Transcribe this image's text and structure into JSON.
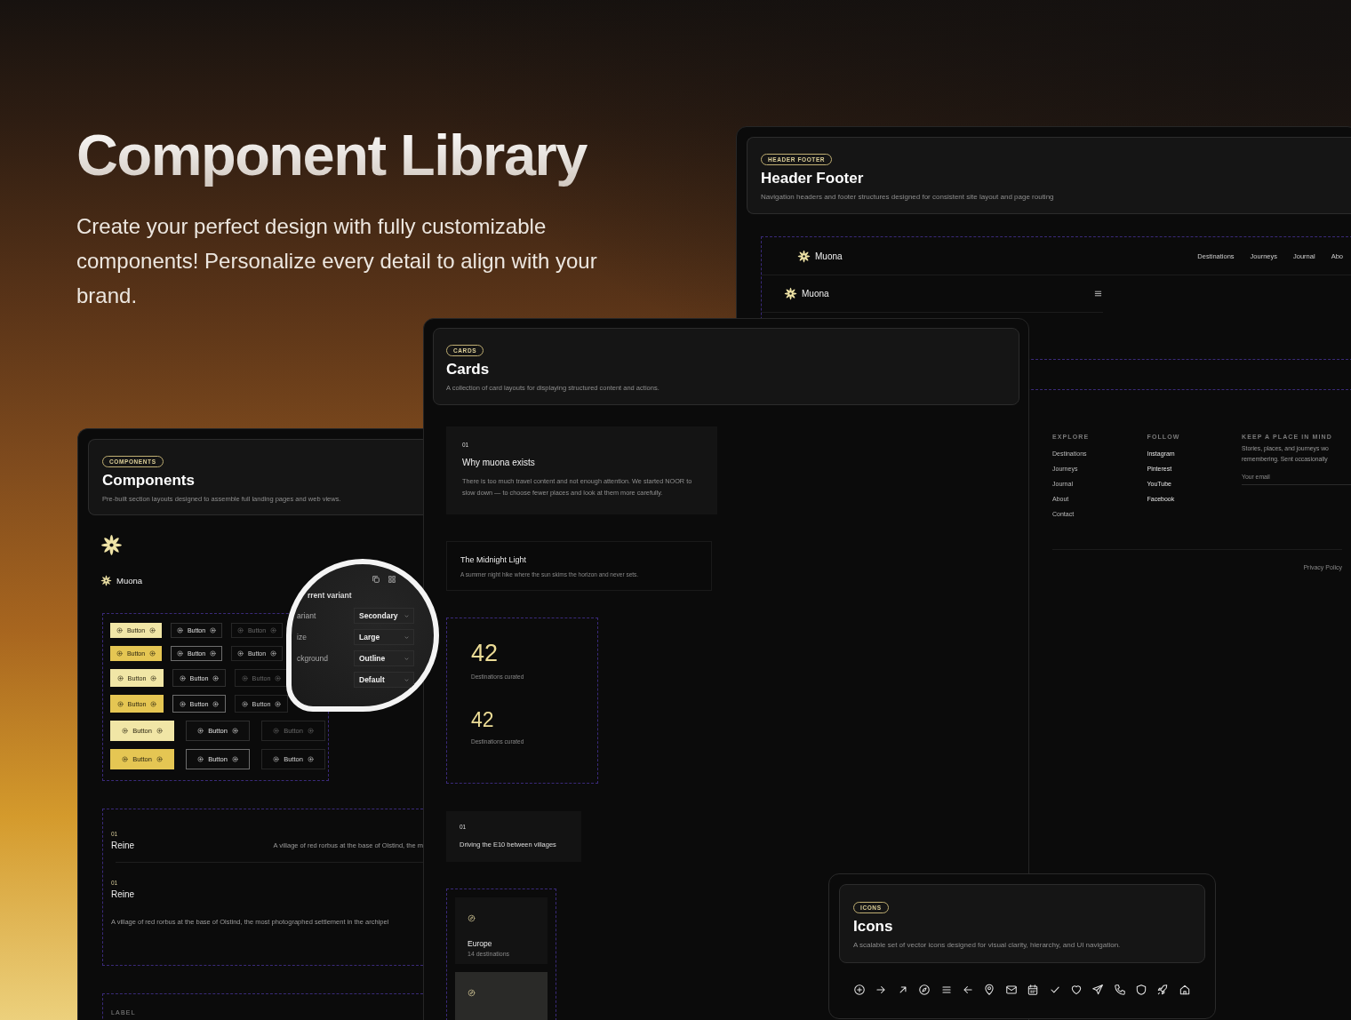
{
  "hero": {
    "title": "Component Library",
    "subtitle": "Create your perfect design with fully customizable components! Personalize every detail to align with your brand."
  },
  "header_footer": {
    "badge": "HEADER FOOTER",
    "title": "Header Footer",
    "description": "Navigation headers and footer structures designed for consistent site layout and page routing",
    "desktop_nav": {
      "brand": "Muona",
      "links": [
        "Destinations",
        "Journeys",
        "Journal",
        "Abo"
      ]
    },
    "mobile_nav": {
      "brand": "Muona"
    },
    "footer": {
      "columns": [
        {
          "heading": "EXPLORE",
          "links": [
            "Destinations",
            "Journeys",
            "Journal",
            "About",
            "Contact"
          ]
        },
        {
          "heading": "FOLLOW",
          "links": [
            "Instagram",
            "Pinterest",
            "YouTube",
            "Facebook"
          ]
        }
      ],
      "newsletter": {
        "heading": "KEEP A PLACE IN MIND",
        "lines": [
          "Stories, places, and journeys wo",
          "remembering. Sent occasionally"
        ],
        "email_placeholder": "Your email"
      },
      "legal_link": "Privacy Policy"
    }
  },
  "components": {
    "badge": "COMPONENTS",
    "title": "Components",
    "description": "Pre-built section layouts designed to assemble full landing pages and web views.",
    "brand": "Muona",
    "button_rows": [
      {
        "kind": "small",
        "buttons": [
          {
            "label": "Button",
            "kind": "primary",
            "hover": false
          },
          {
            "label": "Button",
            "kind": "outline",
            "hover": false
          },
          {
            "label": "Button",
            "kind": "ghost",
            "hover": false
          }
        ]
      },
      {
        "kind": "small",
        "buttons": [
          {
            "label": "Button",
            "kind": "primary",
            "hover": true
          },
          {
            "label": "Button",
            "kind": "outline",
            "hover": true
          },
          {
            "label": "Button",
            "kind": "ghost",
            "hover": true
          }
        ]
      },
      {
        "kind": "medium",
        "buttons": [
          {
            "label": "Button",
            "kind": "primary",
            "hover": false
          },
          {
            "label": "Button",
            "kind": "outline",
            "hover": false
          },
          {
            "label": "Button",
            "kind": "ghost",
            "hover": false
          }
        ]
      },
      {
        "kind": "medium",
        "buttons": [
          {
            "label": "Button",
            "kind": "primary",
            "hover": true
          },
          {
            "label": "Button",
            "kind": "outline",
            "hover": true
          },
          {
            "label": "Button",
            "kind": "ghost",
            "hover": true
          }
        ]
      },
      {
        "kind": "large",
        "buttons": [
          {
            "label": "Button",
            "kind": "primary",
            "hover": false
          },
          {
            "label": "Button",
            "kind": "outline",
            "hover": false
          },
          {
            "label": "Button",
            "kind": "ghost",
            "hover": false
          }
        ]
      },
      {
        "kind": "large",
        "buttons": [
          {
            "label": "Button",
            "kind": "primary",
            "hover": true
          },
          {
            "label": "Button",
            "kind": "outline",
            "hover": true
          },
          {
            "label": "Button",
            "kind": "ghost",
            "hover": true
          }
        ]
      }
    ],
    "list": [
      {
        "kind": "inline",
        "number": "01",
        "title": "Reine",
        "text": "A village of red rorbus at the base of Olstind, the m"
      },
      {
        "kind": "stacked",
        "number": "01",
        "title": "Reine",
        "text": "A village of red rorbus at the base of Olstind, the most photographed settlement in the archipel"
      }
    ],
    "label": "LABEL"
  },
  "inspector": {
    "heading": "rrent variant",
    "fields": [
      {
        "label": "ariant",
        "value": "Secondary"
      },
      {
        "label": "ize",
        "value": "Large"
      },
      {
        "label": "ckground",
        "value": "Outline"
      },
      {
        "value": "Default"
      }
    ]
  },
  "cards": {
    "badge": "CARDS",
    "title": "Cards",
    "description": "A collection of card layouts for displaying structured content and actions.",
    "items": [
      {
        "kind": "feature",
        "number": "01",
        "title": "Why muona exists",
        "text": "There is too much travel content and not enough attention. We started NOOR to slow down — to choose fewer places and look at them more carefully."
      },
      {
        "kind": "simple",
        "title": "The Midnight Light",
        "text": "A summer night hike where the sun skims the horizon and never sets."
      },
      {
        "kind": "stats",
        "stats": [
          {
            "value": "42",
            "label": "Destinations curated"
          },
          {
            "value": "42",
            "label": "Destinations curated"
          }
        ]
      },
      {
        "kind": "numbered",
        "number": "01",
        "title": "Driving the E10 between villages"
      },
      {
        "kind": "regions",
        "regions": [
          {
            "name": "Europe",
            "count": "14 destinations",
            "highlighted": false
          },
          {
            "highlighted": true
          }
        ]
      }
    ]
  },
  "icons": {
    "badge": "ICONS",
    "title": "Icons",
    "description": "A scalable set of vector icons designed for visual clarity, hierarchy, and UI navigation."
  }
}
